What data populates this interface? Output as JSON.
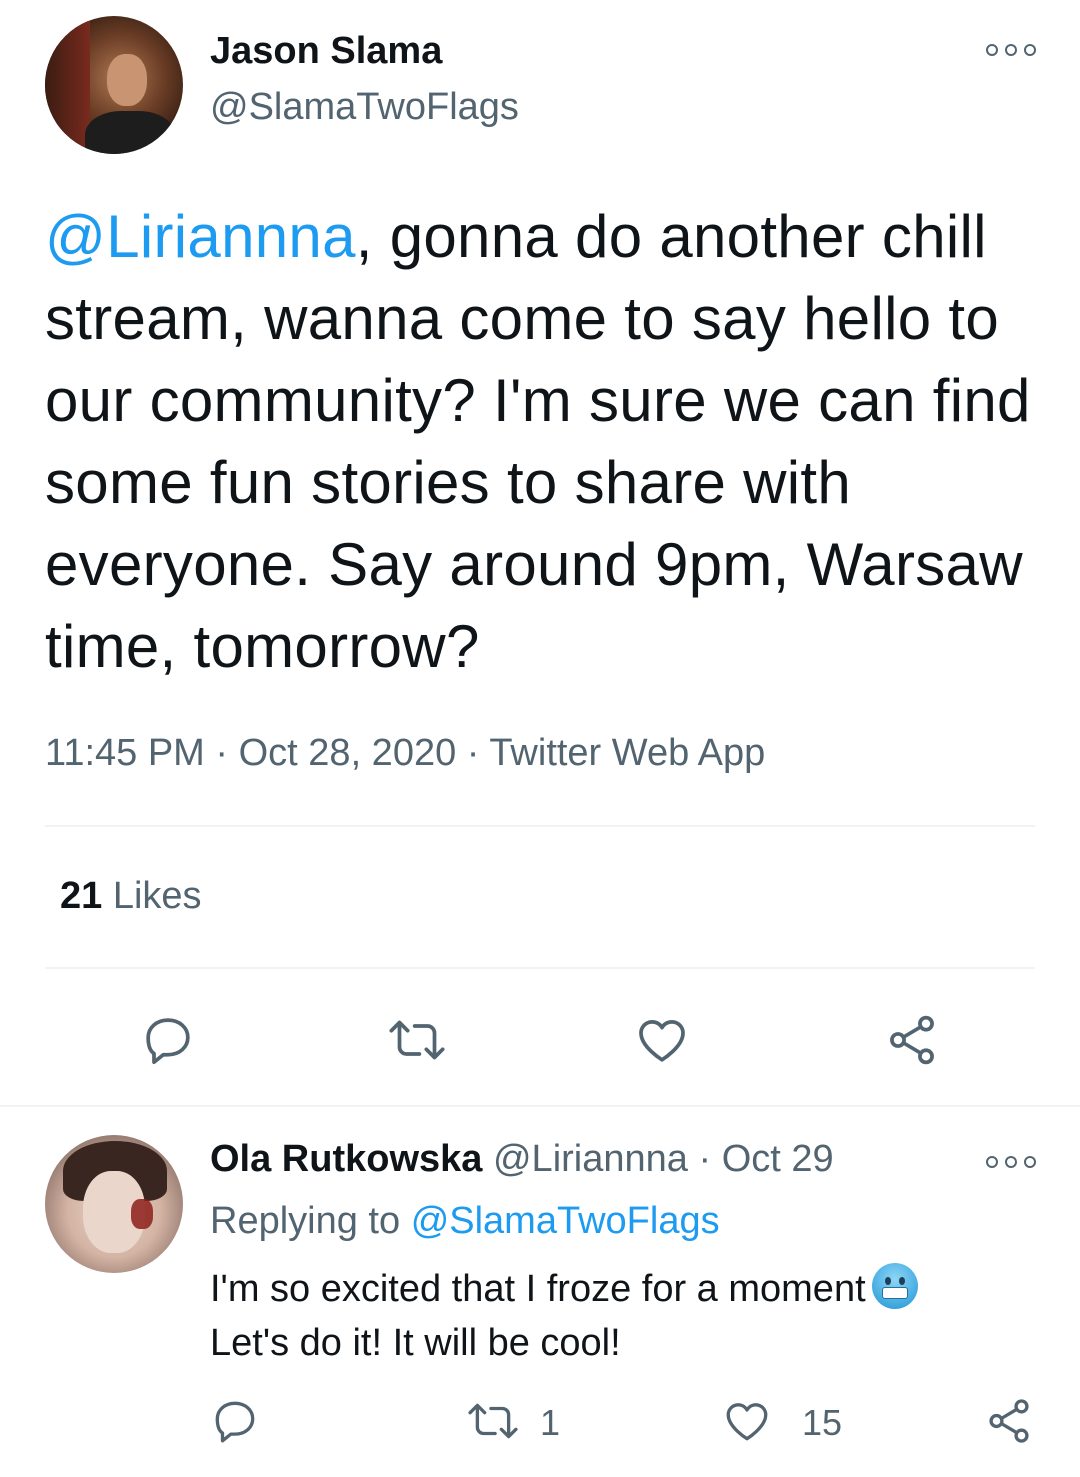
{
  "tweet": {
    "author_name": "Jason Slama",
    "author_handle": "@SlamaTwoFlags",
    "text_mention": "@Liriannna",
    "text_body": ", gonna do another chill stream, wanna come to say hello to our community? I'm sure we can find some fun stories to share with everyone. Say around 9pm, Warsaw time, tomorrow?",
    "time": "11:45 PM",
    "date": "Oct 28, 2020",
    "source": "Twitter Web App",
    "likes_count": "21",
    "likes_label": "Likes"
  },
  "reply": {
    "author_name": "Ola Rutkowska",
    "author_handle": "@Liriannna",
    "date": "Oct 29",
    "replying_label": "Replying to",
    "replying_handle": "@SlamaTwoFlags",
    "line1": "I'm so excited that I froze for a moment",
    "line2": "Let's do it! It will be cool!",
    "retweet_count": "1",
    "like_count": "15"
  },
  "separator": "·",
  "icons": {
    "more": "more-icon",
    "reply": "reply-icon",
    "retweet": "retweet-icon",
    "like": "heart-icon",
    "share": "share-icon",
    "emoji": "cold-face-emoji"
  },
  "colors": {
    "link": "#1d9bf0",
    "secondary_text": "#536471",
    "primary_text": "#0f1419",
    "divider": "#eff3f4"
  }
}
